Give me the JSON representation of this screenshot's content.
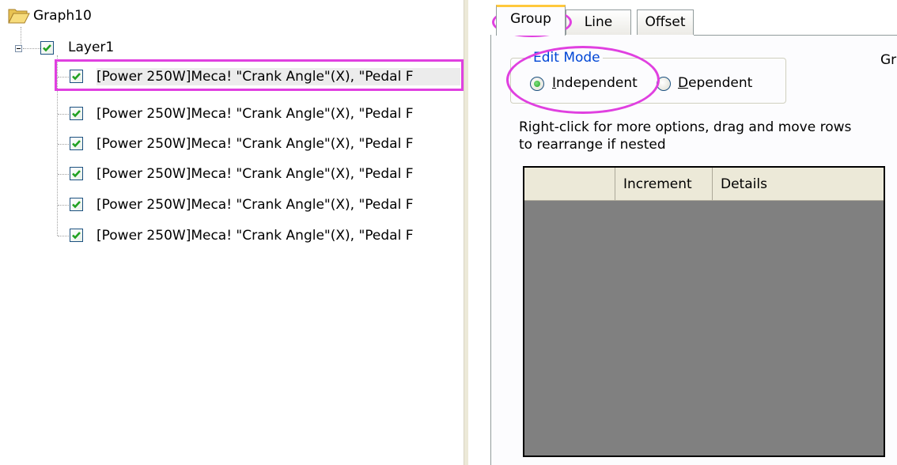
{
  "tree": {
    "root_label": "Graph10",
    "layer_label": "Layer1",
    "plots": [
      {
        "label": "[Power 250W]Meca! \"Crank Angle\"(X), \"Pedal F",
        "checked": true,
        "selected": true
      },
      {
        "label": "[Power 250W]Meca! \"Crank Angle\"(X), \"Pedal F",
        "checked": true,
        "selected": false
      },
      {
        "label": "[Power 250W]Meca! \"Crank Angle\"(X), \"Pedal F",
        "checked": true,
        "selected": false
      },
      {
        "label": "[Power 250W]Meca! \"Crank Angle\"(X), \"Pedal F",
        "checked": true,
        "selected": false
      },
      {
        "label": "[Power 250W]Meca! \"Crank Angle\"(X), \"Pedal F",
        "checked": true,
        "selected": false
      },
      {
        "label": "[Power 250W]Meca! \"Crank Angle\"(X), \"Pedal F",
        "checked": true,
        "selected": false
      }
    ]
  },
  "tabs": [
    {
      "label": "Group",
      "active": true
    },
    {
      "label": "Line",
      "active": false
    },
    {
      "label": "Offset",
      "active": false
    }
  ],
  "edit_mode": {
    "legend": "Edit Mode",
    "options": [
      {
        "label": "Independent",
        "mnemonic": "I",
        "rest": "ndependent",
        "selected": true
      },
      {
        "label": "Dependent",
        "mnemonic": "D",
        "rest": "ependent",
        "selected": false
      }
    ]
  },
  "clipped_label": "Gr",
  "hint_text": "Right-click for more options, drag and move rows to  rearrange if nested",
  "grid": {
    "columns": [
      "",
      "Increment",
      "Details"
    ]
  },
  "colors": {
    "highlight": "#e040e0",
    "legend_text": "#0046d5",
    "grid_background": "#808080",
    "active_tab_accent": "#ffc83c",
    "check_green": "#21a121"
  },
  "icons": {
    "root": "folder-open-icon",
    "checkbox": "checkmark-icon",
    "expander": "collapse-minus-icon"
  }
}
